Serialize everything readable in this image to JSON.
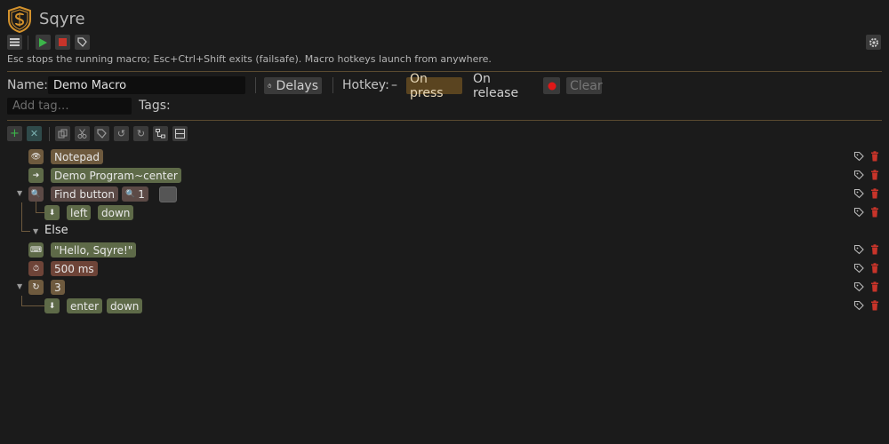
{
  "app": {
    "title": "Sqyre"
  },
  "hint": "Esc stops the running macro; Esc+Ctrl+Shift exits (failsafe). Macro hotkeys launch from anywhere.",
  "form": {
    "name_label": "Name:",
    "name_value": "Demo Macro",
    "delays_label": "Delays",
    "hotkey_label": "Hotkey:",
    "hotkey_value": "–",
    "on_press": "On press",
    "on_release": "On release",
    "clear": "Clear",
    "tag_placeholder": "Add tag…",
    "tags_label": "Tags:"
  },
  "tree": {
    "else_label": "Else",
    "rows": [
      {
        "pills": [
          "Notepad"
        ]
      },
      {
        "pills": [
          "Demo Program~center"
        ]
      },
      {
        "pills": [
          "Find button",
          "1"
        ]
      },
      {
        "pills": [
          "left",
          "down"
        ]
      },
      {
        "pills": [
          "\"Hello, Sqyre!\""
        ]
      },
      {
        "pills": [
          "500 ms"
        ]
      },
      {
        "pills": [
          "3"
        ]
      },
      {
        "pills": [
          "enter",
          "down"
        ]
      }
    ]
  },
  "colors": {
    "accent": "#d4922c",
    "olive": "#5e6a48",
    "brown": "#6e5a3e",
    "red": "#c8342a",
    "highlight": "#5a4420"
  }
}
